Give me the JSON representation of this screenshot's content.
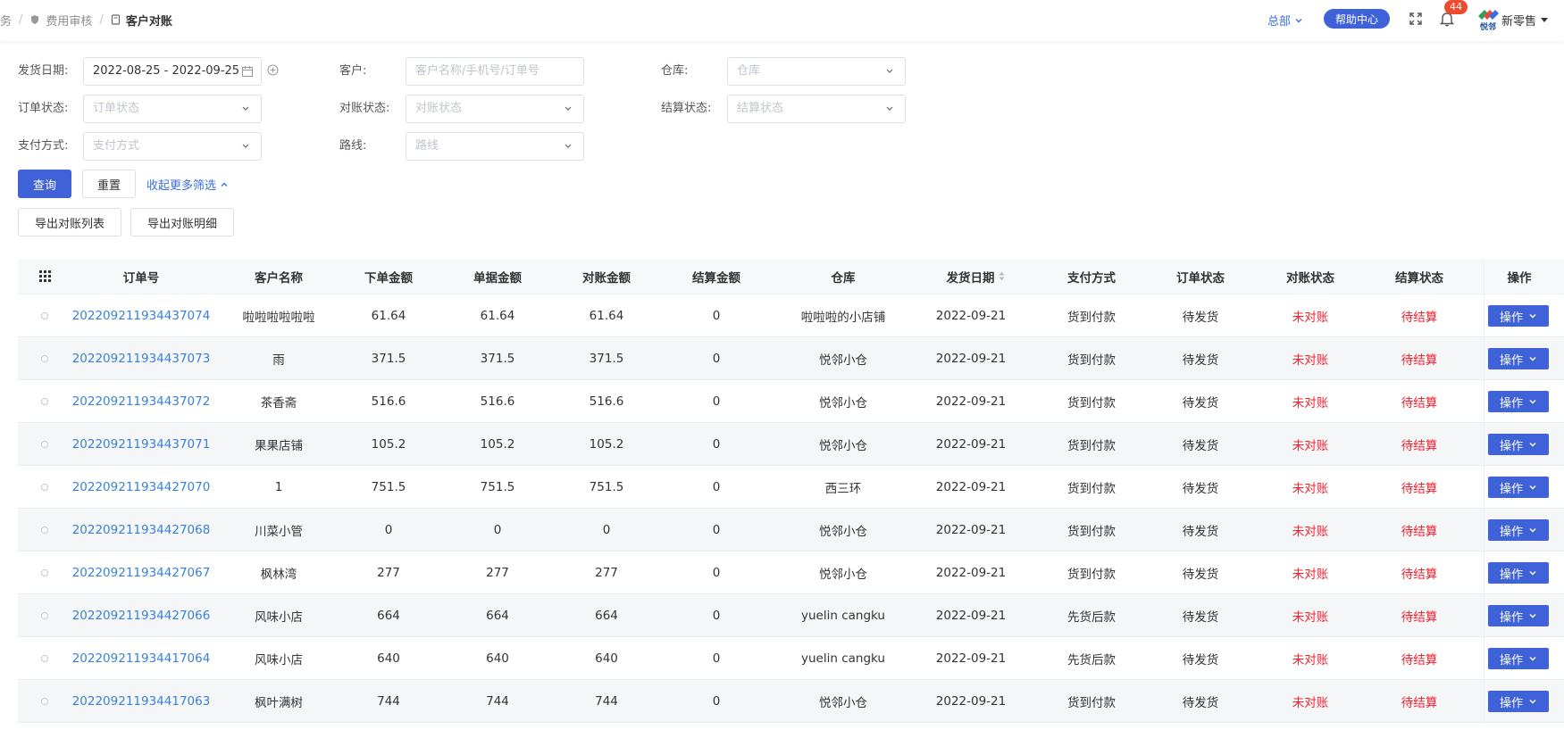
{
  "breadcrumb": {
    "items": [
      {
        "label": "务"
      },
      {
        "label": "费用审核"
      },
      {
        "label": "客户对账"
      }
    ]
  },
  "header": {
    "org": "总部",
    "help": "帮助中心",
    "badge_count": "44",
    "brand": "新零售",
    "logo_text": "悦邻"
  },
  "filters": {
    "ship_date": {
      "label": "发货日期:",
      "value": "2022-08-25 - 2022-09-25"
    },
    "customer": {
      "label": "客户:",
      "placeholder": "客户名称/手机号/订单号"
    },
    "warehouse": {
      "label": "仓库:",
      "placeholder": "仓库"
    },
    "order_status": {
      "label": "订单状态:",
      "placeholder": "订单状态"
    },
    "recon_status": {
      "label": "对账状态:",
      "placeholder": "对账状态"
    },
    "settle_status": {
      "label": "结算状态:",
      "placeholder": "结算状态"
    },
    "pay_method": {
      "label": "支付方式:",
      "placeholder": "支付方式"
    },
    "route": {
      "label": "路线:",
      "placeholder": "路线"
    }
  },
  "actions": {
    "query": "查询",
    "reset": "重置",
    "collapse": "收起更多筛选",
    "export_list": "导出对账列表",
    "export_detail": "导出对账明细"
  },
  "table": {
    "columns": [
      "订单号",
      "客户名称",
      "下单金额",
      "单据金额",
      "对账金额",
      "结算金额",
      "仓库",
      "发货日期",
      "支付方式",
      "订单状态",
      "对账状态",
      "结算状态",
      "操作"
    ],
    "op_label": "操作",
    "rows": [
      {
        "order": "202209211934437074",
        "customer": "啦啦啦啦啦啦",
        "order_amt": "61.64",
        "bill_amt": "61.64",
        "recon_amt": "61.64",
        "settle_amt": "0",
        "warehouse": "啦啦啦的小店铺",
        "date": "2022-09-21",
        "pay": "货到付款",
        "order_status": "待发货",
        "recon_status": "未对账",
        "settle_status": "待结算"
      },
      {
        "order": "202209211934437073",
        "customer": "雨",
        "order_amt": "371.5",
        "bill_amt": "371.5",
        "recon_amt": "371.5",
        "settle_amt": "0",
        "warehouse": "悦邻小仓",
        "date": "2022-09-21",
        "pay": "货到付款",
        "order_status": "待发货",
        "recon_status": "未对账",
        "settle_status": "待结算"
      },
      {
        "order": "202209211934437072",
        "customer": "茶香斋",
        "order_amt": "516.6",
        "bill_amt": "516.6",
        "recon_amt": "516.6",
        "settle_amt": "0",
        "warehouse": "悦邻小仓",
        "date": "2022-09-21",
        "pay": "货到付款",
        "order_status": "待发货",
        "recon_status": "未对账",
        "settle_status": "待结算"
      },
      {
        "order": "202209211934437071",
        "customer": "果果店铺",
        "order_amt": "105.2",
        "bill_amt": "105.2",
        "recon_amt": "105.2",
        "settle_amt": "0",
        "warehouse": "悦邻小仓",
        "date": "2022-09-21",
        "pay": "货到付款",
        "order_status": "待发货",
        "recon_status": "未对账",
        "settle_status": "待结算"
      },
      {
        "order": "202209211934427070",
        "customer": "1",
        "order_amt": "751.5",
        "bill_amt": "751.5",
        "recon_amt": "751.5",
        "settle_amt": "0",
        "warehouse": "西三环",
        "date": "2022-09-21",
        "pay": "货到付款",
        "order_status": "待发货",
        "recon_status": "未对账",
        "settle_status": "待结算"
      },
      {
        "order": "202209211934427068",
        "customer": "川菜小管",
        "order_amt": "0",
        "bill_amt": "0",
        "recon_amt": "0",
        "settle_amt": "0",
        "warehouse": "悦邻小仓",
        "date": "2022-09-21",
        "pay": "货到付款",
        "order_status": "待发货",
        "recon_status": "未对账",
        "settle_status": "待结算"
      },
      {
        "order": "202209211934427067",
        "customer": "枫林湾",
        "order_amt": "277",
        "bill_amt": "277",
        "recon_amt": "277",
        "settle_amt": "0",
        "warehouse": "悦邻小仓",
        "date": "2022-09-21",
        "pay": "货到付款",
        "order_status": "待发货",
        "recon_status": "未对账",
        "settle_status": "待结算"
      },
      {
        "order": "202209211934427066",
        "customer": "风味小店",
        "order_amt": "664",
        "bill_amt": "664",
        "recon_amt": "664",
        "settle_amt": "0",
        "warehouse": "yuelin cangku",
        "date": "2022-09-21",
        "pay": "先货后款",
        "order_status": "待发货",
        "recon_status": "未对账",
        "settle_status": "待结算"
      },
      {
        "order": "202209211934417064",
        "customer": "风味小店",
        "order_amt": "640",
        "bill_amt": "640",
        "recon_amt": "640",
        "settle_amt": "0",
        "warehouse": "yuelin cangku",
        "date": "2022-09-21",
        "pay": "先货后款",
        "order_status": "待发货",
        "recon_status": "未对账",
        "settle_status": "待结算"
      },
      {
        "order": "202209211934417063",
        "customer": "枫叶满树",
        "order_amt": "744",
        "bill_amt": "744",
        "recon_amt": "744",
        "settle_amt": "0",
        "warehouse": "悦邻小仓",
        "date": "2022-09-21",
        "pay": "货到付款",
        "order_status": "待发货",
        "recon_status": "未对账",
        "settle_status": "待结算"
      }
    ]
  },
  "colors": {
    "primary": "#3f62d8",
    "link": "#3a7fd5",
    "danger": "#f5222d",
    "badge": "#f04a2c"
  },
  "icons": {
    "breadcrumb_audit": "shield-icon",
    "breadcrumb_current": "document-icon",
    "fullscreen": "fullscreen-icon",
    "notifications": "bell-icon",
    "calendar": "calendar-icon",
    "add": "plus-circle-icon",
    "columns": "grid-icon",
    "dropdown": "chevron-down-icon",
    "sort": "sort-icon"
  }
}
